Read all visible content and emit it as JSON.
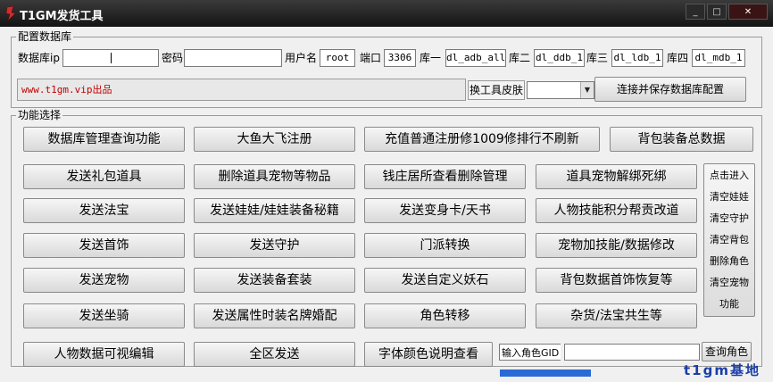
{
  "window": {
    "title": "T1GM发货工具",
    "min": "_",
    "max": "□",
    "close": "✕"
  },
  "db_group": {
    "legend": "配置数据库",
    "ip_label": "数据库ip",
    "ip_value": "",
    "pwd_label": "密码",
    "pwd_value": "",
    "user_label": "用户名",
    "user_value": "root",
    "port_label": "端口",
    "port_value": "3306",
    "db1_label": "库一",
    "db1_value": "dl_adb_all",
    "db2_label": "库二",
    "db2_value": "dl_ddb_1",
    "db3_label": "库三",
    "db3_value": "dl_ldb_1",
    "db4_label": "库四",
    "db4_value": "dl_mdb_1",
    "info_text": "www.t1gm.vip出品",
    "skin_label": "换工具皮肤",
    "skin_value": "",
    "connect_button": "连接并保存数据库配置"
  },
  "func_group": {
    "legend": "功能选择",
    "row1": [
      "数据库管理查询功能",
      "大鱼大飞注册",
      "充值普通注册修1009修排行不刷新",
      "背包装备总数据"
    ],
    "row2": [
      "发送礼包道具",
      "删除道具宠物等物品",
      "钱庄居所查看删除管理",
      "道具宠物解绑死绑"
    ],
    "row3": [
      "发送法宝",
      "发送娃娃/娃娃装备秘籍",
      "发送变身卡/天书",
      "人物技能积分帮贡改道"
    ],
    "row4": [
      "发送首饰",
      "发送守护",
      "门派转换",
      "宠物加技能/数据修改"
    ],
    "row5": [
      "发送宠物",
      "发送装备套装",
      "发送自定义妖石",
      "背包数据首饰恢复等"
    ],
    "row6": [
      "发送坐骑",
      "发送属性时装名牌婚配",
      "角色转移",
      "杂货/法宝共生等"
    ],
    "row7": [
      "人物数据可视编辑",
      "全区发送",
      "字体颜色说明查看"
    ],
    "side_panel": [
      "点击进入",
      "清空娃娃",
      "清空守护",
      "清空背包",
      "删除角色",
      "清空宠物",
      "功能"
    ],
    "gid_label": "输入角色GID",
    "gid_value": "",
    "query_button": "查询角色"
  },
  "brand": "t1gm基地"
}
